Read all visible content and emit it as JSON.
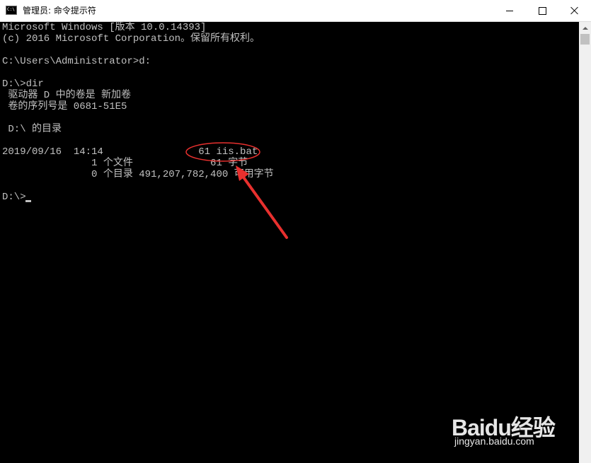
{
  "window": {
    "title": "管理员: 命令提示符",
    "icon": "cmd-icon",
    "icon_text": "C:\\"
  },
  "caption_buttons": {
    "minimize": "minimize-icon",
    "maximize": "maximize-icon",
    "close": "close-icon"
  },
  "console": {
    "lines": [
      "Microsoft Windows [版本 10.0.14393]",
      "(c) 2016 Microsoft Corporation。保留所有权利。",
      "",
      "C:\\Users\\Administrator>d:",
      "",
      "D:\\>dir",
      " 驱动器 D 中的卷是 新加卷",
      " 卷的序列号是 0681-51E5",
      "",
      " D:\\ 的目录",
      "",
      "2019/09/16  14:14                61 iis.bat",
      "               1 个文件             61 字节",
      "               0 个目录 491,207,782,400 可用字节",
      "",
      "D:\\>"
    ]
  },
  "annotation": {
    "color": "#e8302e"
  },
  "watermark": {
    "brand": "Baidu经验",
    "url": "jingyan.baidu.com"
  }
}
